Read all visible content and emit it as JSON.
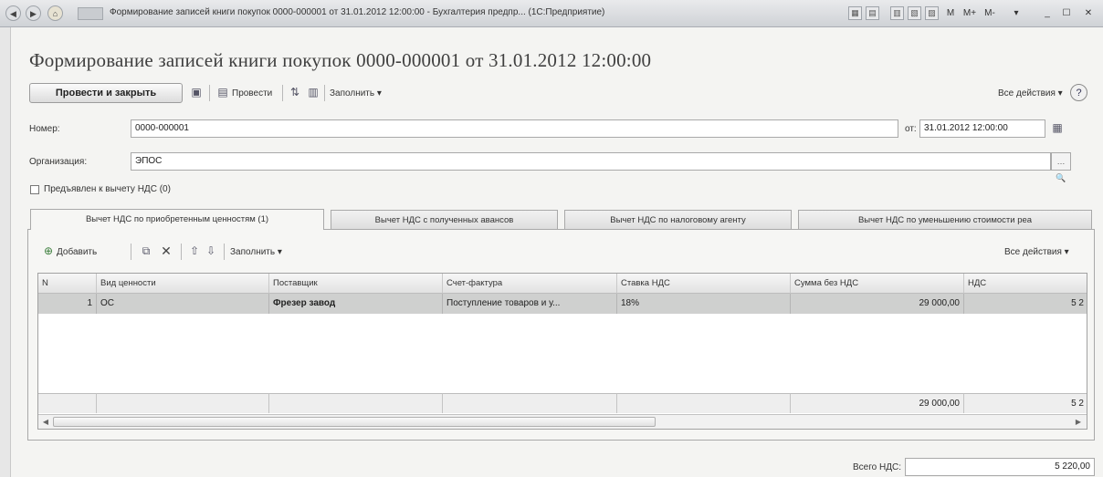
{
  "window": {
    "title": "Формирование записей книги покупок 0000-000001 от 31.01.2012 12:00:00 - Бухгалтерия предпр... (1С:Предприятие)",
    "controls": {
      "m": "M",
      "m_plus": "M+",
      "m_minus": "M-",
      "minimize": "_",
      "maximize": "☐",
      "close": "✕"
    }
  },
  "page": {
    "title": "Формирование записей книги покупок 0000-000001 от 31.01.2012 12:00:00"
  },
  "toolbar": {
    "post_close": "Провести и закрыть",
    "post": "Провести",
    "fill": "Заполнить ▾",
    "all_actions": "Все действия ▾",
    "help": "?"
  },
  "form": {
    "number_label": "Номер:",
    "number_value": "0000-000001",
    "date_label": "от:",
    "date_value": "31.01.2012 12:00:00",
    "org_label": "Организация:",
    "org_value": "ЭПОС",
    "vat_checkbox_label": "Предъявлен к вычету НДС (0)"
  },
  "tabs": [
    "Вычет НДС по приобретенным ценностям (1)",
    "Вычет НДС с полученных авансов",
    "Вычет НДС по налоговому агенту",
    "Вычет НДС по уменьшению стоимости реа"
  ],
  "table_toolbar": {
    "add": "Добавить",
    "fill": "Заполнить ▾",
    "all_actions": "Все действия ▾"
  },
  "table": {
    "columns": [
      "N",
      "Вид ценности",
      "Поставщик",
      "Счет-фактура",
      "Ставка НДС",
      "Сумма без НДС",
      "НДС"
    ],
    "rows": [
      [
        "1",
        "ОС",
        "Фрезер завод",
        "Поступление товаров и у...",
        "18%",
        "29 000,00",
        "5 2"
      ]
    ],
    "footer": {
      "sum": "29 000,00",
      "vat": "5 2"
    }
  },
  "totals": {
    "label": "Всего НДС:",
    "value": "5 220,00"
  }
}
